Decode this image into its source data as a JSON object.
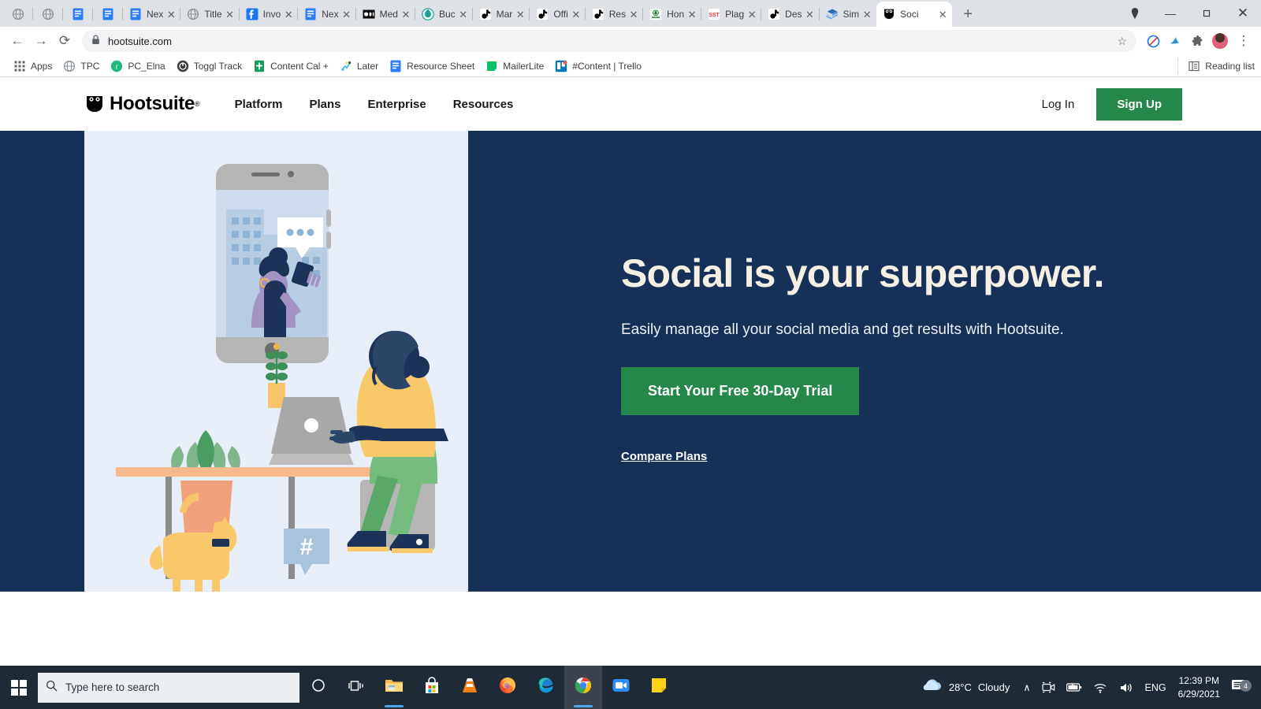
{
  "browser": {
    "tabs": [
      {
        "title": "",
        "icon": "globe-icon",
        "pinned": true
      },
      {
        "title": "",
        "icon": "globe-icon",
        "pinned": true
      },
      {
        "title": "",
        "icon": "doc-blue-icon",
        "pinned": true
      },
      {
        "title": "",
        "icon": "doc-blue-icon",
        "pinned": true
      },
      {
        "title": "Nex",
        "icon": "doc-blue-icon",
        "pinned": false
      },
      {
        "title": "Title",
        "icon": "globe-icon",
        "pinned": false
      },
      {
        "title": "Invo",
        "icon": "f-blue-icon",
        "pinned": false
      },
      {
        "title": "Nex",
        "icon": "doc-blue-icon",
        "pinned": false
      },
      {
        "title": "Med",
        "icon": "medium-icon",
        "pinned": false
      },
      {
        "title": "Buc",
        "icon": "buffer-icon",
        "pinned": false
      },
      {
        "title": "Mar",
        "icon": "tiktok-icon",
        "pinned": false
      },
      {
        "title": "Offi",
        "icon": "tiktok-icon",
        "pinned": false
      },
      {
        "title": "Res",
        "icon": "tiktok-icon",
        "pinned": false
      },
      {
        "title": "Hon",
        "icon": "seal-green-icon",
        "pinned": false
      },
      {
        "title": "Plag",
        "icon": "sst-icon",
        "pinned": false
      },
      {
        "title": "Des",
        "icon": "tiktok-icon",
        "pinned": false
      },
      {
        "title": "Sim",
        "icon": "layers-icon",
        "pinned": false
      },
      {
        "title": "Soci",
        "icon": "hootsuite-owl-icon",
        "pinned": false,
        "active": true
      }
    ],
    "new_tab_label": "+",
    "close_label": "✕",
    "window_controls": {
      "minimize": "—",
      "maximize": "❐",
      "close": "✕"
    },
    "toolbar": {
      "back": "←",
      "forward": "→",
      "reload": "⟳",
      "lock_icon": "lock-icon",
      "url": "hootsuite.com",
      "star": "☆"
    },
    "bookmarks": [
      {
        "label": "Apps",
        "icon": "apps-grid-icon"
      },
      {
        "label": "TPC",
        "icon": "globe-icon"
      },
      {
        "label": "PC_Elna",
        "icon": "t-green-icon"
      },
      {
        "label": "Toggl Track",
        "icon": "toggl-icon"
      },
      {
        "label": "Content Cal +",
        "icon": "sheets-icon"
      },
      {
        "label": "Later",
        "icon": "later-icon"
      },
      {
        "label": "Resource Sheet",
        "icon": "doc-blue-icon"
      },
      {
        "label": "MailerLite",
        "icon": "mailerlite-icon"
      },
      {
        "label": "#Content | Trello",
        "icon": "trello-icon"
      }
    ],
    "reading_list": {
      "label": "Reading list",
      "icon": "reading-list-icon"
    }
  },
  "site": {
    "logo": {
      "word": "Hootsuite",
      "registered": "®",
      "icon": "hootsuite-owl-icon"
    },
    "nav": [
      {
        "label": "Platform"
      },
      {
        "label": "Plans"
      },
      {
        "label": "Enterprise"
      },
      {
        "label": "Resources"
      }
    ],
    "login_label": "Log In",
    "signup_label": "Sign Up",
    "hero": {
      "headline": "Social is your superpower.",
      "subhead": "Easily manage all your social media and get results with Hootsuite.",
      "cta_label": "Start Your Free 30-Day Trial",
      "secondary_link": "Compare Plans"
    },
    "colors": {
      "navy": "#163058",
      "green": "#26874a",
      "panel": "#e8eef7",
      "cream": "#f6efe3"
    }
  },
  "taskbar": {
    "start_icon": "windows-start-icon",
    "search_placeholder": "Type here to search",
    "search_icon": "search-icon",
    "items": [
      {
        "icon": "cortana-icon",
        "name": "cortana"
      },
      {
        "icon": "task-view-icon",
        "name": "task-view"
      },
      {
        "icon": "file-explorer-icon",
        "name": "file-explorer"
      },
      {
        "icon": "microsoft-store-icon",
        "name": "microsoft-store"
      },
      {
        "icon": "vlc-icon",
        "name": "vlc"
      },
      {
        "icon": "firefox-icon",
        "name": "firefox"
      },
      {
        "icon": "edge-icon",
        "name": "edge"
      },
      {
        "icon": "chrome-icon",
        "name": "chrome"
      },
      {
        "icon": "zoom-icon",
        "name": "zoom"
      },
      {
        "icon": "sticky-notes-icon",
        "name": "sticky-notes"
      }
    ],
    "tray": {
      "weather_temp": "28°C",
      "weather_desc": "Cloudy",
      "weather_icon": "cloud-icon",
      "chevron": "∧",
      "language": "ENG",
      "time": "12:39 PM",
      "date": "6/29/2021",
      "notification_count": "4"
    }
  }
}
